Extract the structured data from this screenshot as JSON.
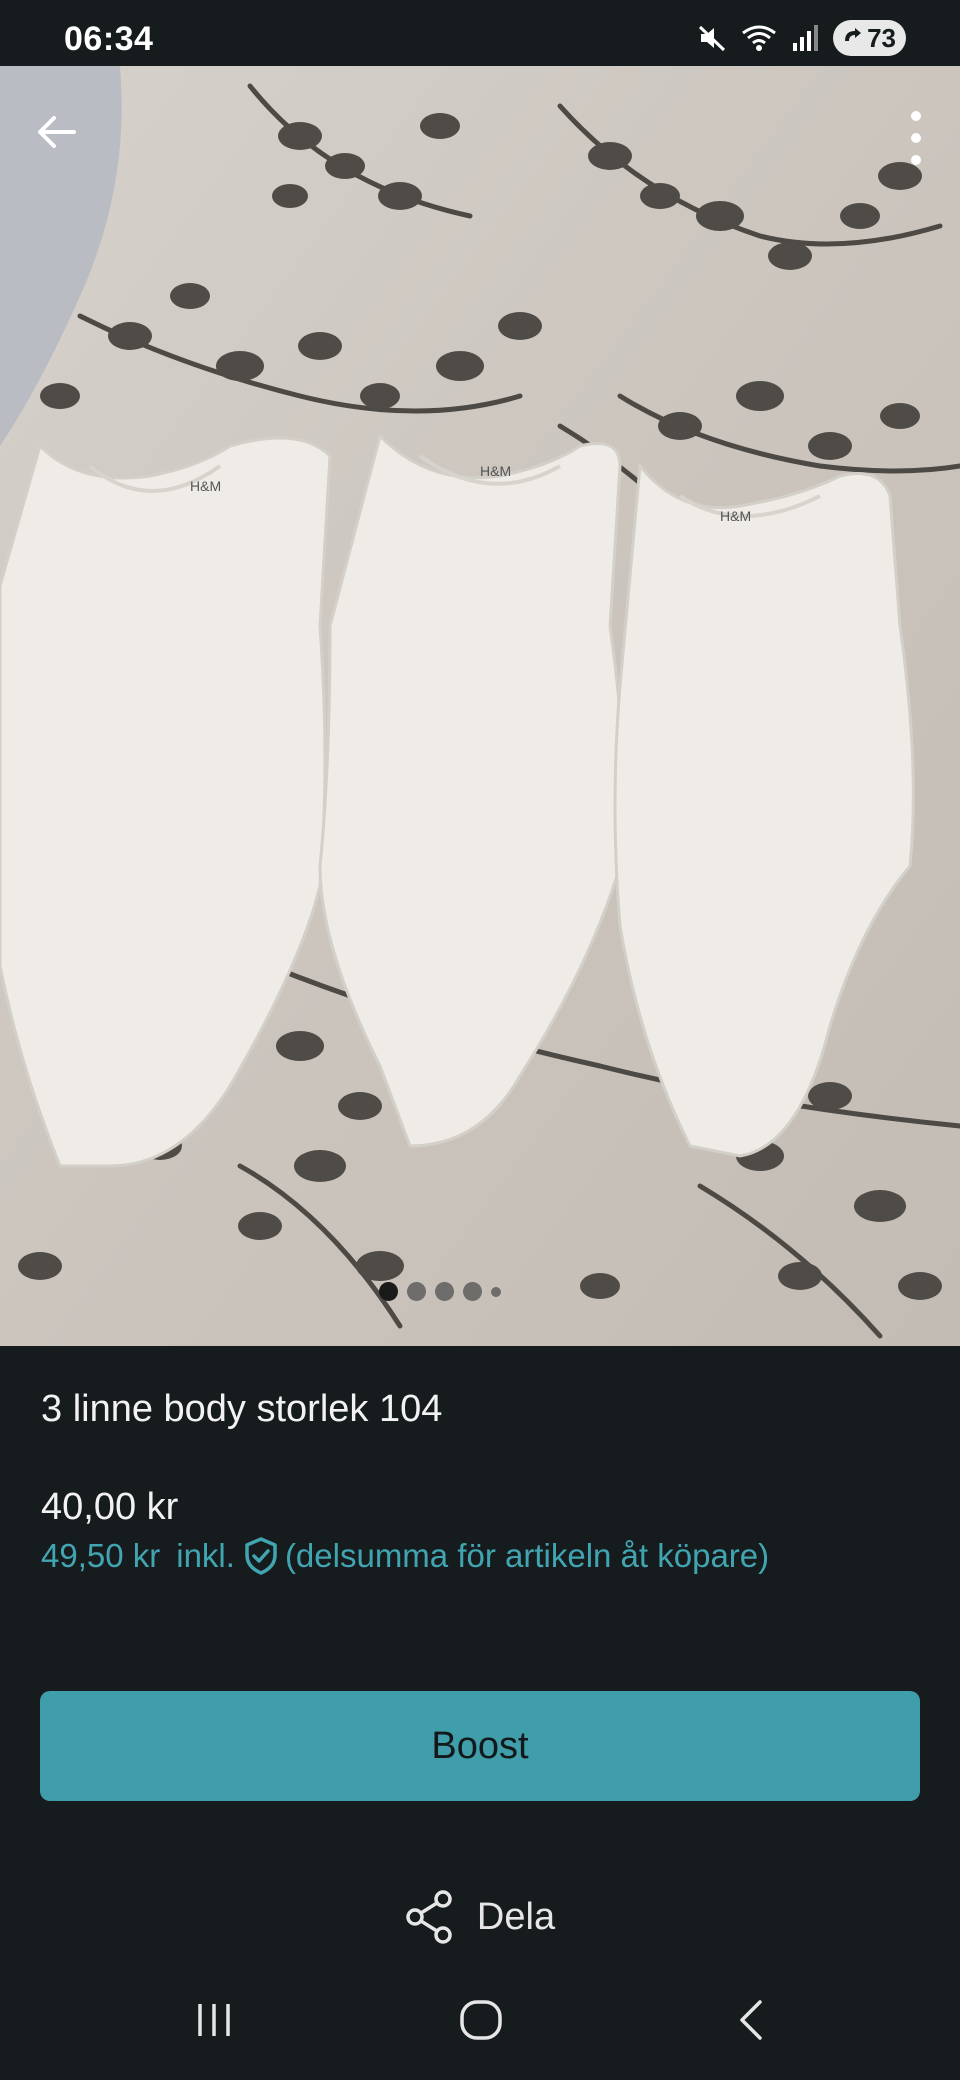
{
  "status_bar": {
    "time": "06:34",
    "battery": "73",
    "icons": [
      "mute-icon",
      "wifi-icon",
      "signal-icon",
      "battery-icon"
    ]
  },
  "toolbar": {
    "back_icon": "arrow-left-icon",
    "more_icon": "more-vertical-icon"
  },
  "gallery": {
    "image_count": 5,
    "active_index": 0
  },
  "listing": {
    "title": "3 linne body storlek 104",
    "price": "40,00 kr",
    "buyer_price": "49,50 kr",
    "inkl_label": "inkl.",
    "buyer_price_note": "(delsumma för artikeln åt köpare)"
  },
  "actions": {
    "boost_label": "Boost",
    "share_label": "Dela"
  },
  "colors": {
    "background": "#161c1e",
    "accent": "#41a5b1",
    "button": "#3f9ea9"
  }
}
